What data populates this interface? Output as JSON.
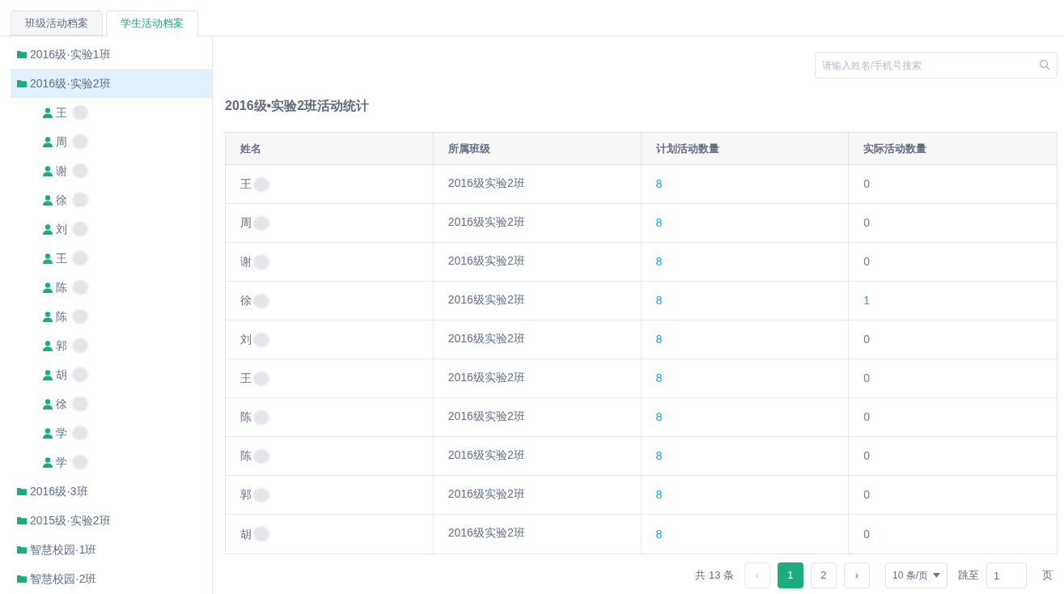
{
  "tabs": [
    {
      "label": "班级活动档案",
      "selected": false
    },
    {
      "label": "学生活动档案",
      "selected": true
    }
  ],
  "tree": [
    {
      "label": "2016级·实验1班",
      "selected": false
    },
    {
      "label": "2016级·实验2班",
      "selected": true,
      "children": [
        {
          "label": "王"
        },
        {
          "label": "周"
        },
        {
          "label": "谢"
        },
        {
          "label": "徐"
        },
        {
          "label": "刘"
        },
        {
          "label": "王"
        },
        {
          "label": "陈"
        },
        {
          "label": "陈"
        },
        {
          "label": "郭"
        },
        {
          "label": "胡"
        },
        {
          "label": "徐"
        },
        {
          "label": "学"
        },
        {
          "label": "学"
        }
      ]
    },
    {
      "label": "2016级·3班",
      "selected": false
    },
    {
      "label": "2015级·实验2班",
      "selected": false
    },
    {
      "label": "智慧校园·1班",
      "selected": false
    },
    {
      "label": "智慧校园·2班",
      "selected": false
    }
  ],
  "search": {
    "placeholder": "请输入姓名/手机号搜索"
  },
  "title": "2016级•实验2班活动统计",
  "table": {
    "columns": [
      "姓名",
      "所属班级",
      "计划活动数量",
      "实际活动数量"
    ],
    "rows": [
      {
        "name": "王",
        "class": "2016级实验2班",
        "planned": "8",
        "actual": "0",
        "actual_link": false
      },
      {
        "name": "周",
        "class": "2016级实验2班",
        "planned": "8",
        "actual": "0",
        "actual_link": false
      },
      {
        "name": "谢",
        "class": "2016级实验2班",
        "planned": "8",
        "actual": "0",
        "actual_link": false
      },
      {
        "name": "徐",
        "class": "2016级实验2班",
        "planned": "8",
        "actual": "1",
        "actual_link": true
      },
      {
        "name": "刘",
        "class": "2016级实验2班",
        "planned": "8",
        "actual": "0",
        "actual_link": false
      },
      {
        "name": "王",
        "class": "2016级实验2班",
        "planned": "8",
        "actual": "0",
        "actual_link": false
      },
      {
        "name": "陈",
        "class": "2016级实验2班",
        "planned": "8",
        "actual": "0",
        "actual_link": false
      },
      {
        "name": "陈",
        "class": "2016级实验2班",
        "planned": "8",
        "actual": "0",
        "actual_link": false
      },
      {
        "name": "郭",
        "class": "2016级实验2班",
        "planned": "8",
        "actual": "0",
        "actual_link": false
      },
      {
        "name": "胡",
        "class": "2016级实验2班",
        "planned": "8",
        "actual": "0",
        "actual_link": false
      }
    ]
  },
  "pagination": {
    "total": "共 13 条",
    "prev": "‹",
    "pages": [
      {
        "label": "1",
        "selected": true
      },
      {
        "label": "2",
        "selected": false
      }
    ],
    "next": "›",
    "page_size": "10 条/页",
    "jump_label": "跳至",
    "jump_value": "1",
    "page_unit": "页"
  }
}
